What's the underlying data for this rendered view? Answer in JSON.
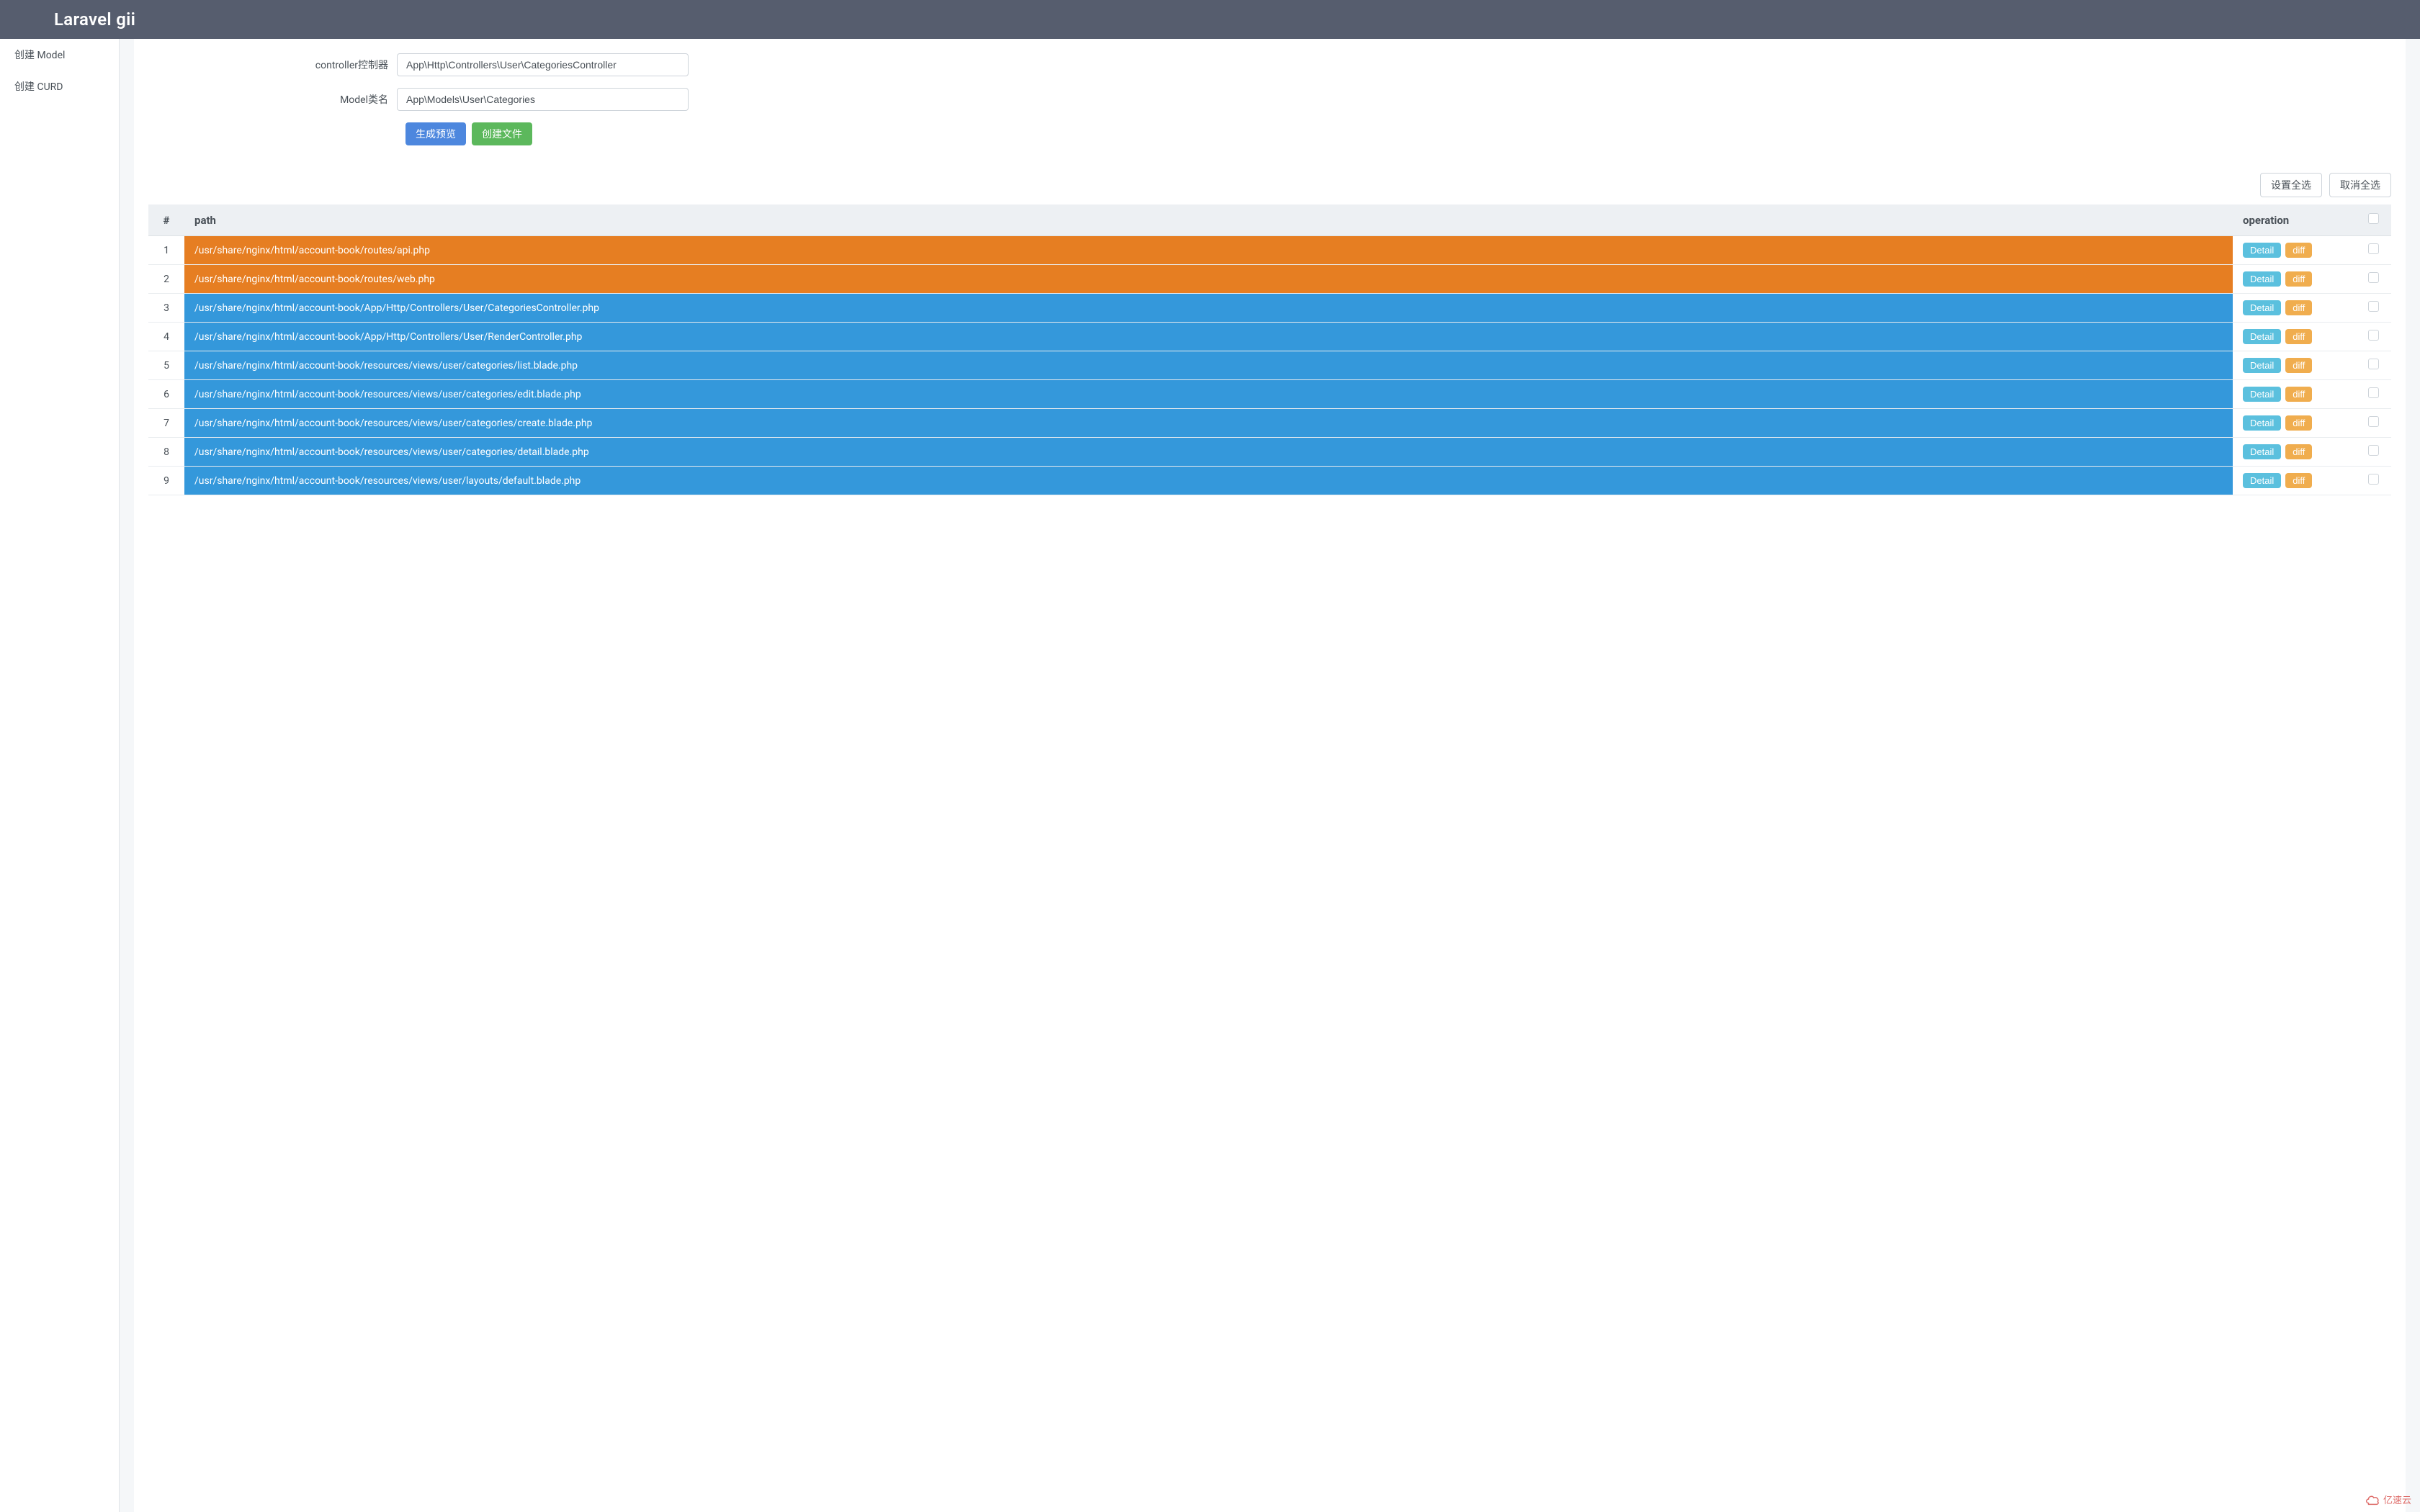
{
  "header": {
    "title": "Laravel gii"
  },
  "sidebar": {
    "items": [
      {
        "label": "创建 Model"
      },
      {
        "label": "创建 CURD"
      }
    ]
  },
  "form": {
    "controller_label": "controller控制器",
    "controller_value": "App\\Http\\Controllers\\User\\CategoriesController",
    "model_label": "Model类名",
    "model_value": "App\\Models\\User\\Categories",
    "preview_button": "生成预览",
    "create_button": "创建文件"
  },
  "select_buttons": {
    "select_all": "设置全选",
    "deselect_all": "取消全选"
  },
  "table": {
    "headers": {
      "index": "#",
      "path": "path",
      "operation": "operation"
    },
    "detail_label": "Detail",
    "diff_label": "diff",
    "rows": [
      {
        "index": "1",
        "path": "/usr/share/nginx/html/account-book/routes/api.php",
        "status": "orange"
      },
      {
        "index": "2",
        "path": "/usr/share/nginx/html/account-book/routes/web.php",
        "status": "orange"
      },
      {
        "index": "3",
        "path": "/usr/share/nginx/html/account-book/App/Http/Controllers/User/CategoriesController.php",
        "status": "blue"
      },
      {
        "index": "4",
        "path": "/usr/share/nginx/html/account-book/App/Http/Controllers/User/RenderController.php",
        "status": "blue"
      },
      {
        "index": "5",
        "path": "/usr/share/nginx/html/account-book/resources/views/user/categories/list.blade.php",
        "status": "blue"
      },
      {
        "index": "6",
        "path": "/usr/share/nginx/html/account-book/resources/views/user/categories/edit.blade.php",
        "status": "blue"
      },
      {
        "index": "7",
        "path": "/usr/share/nginx/html/account-book/resources/views/user/categories/create.blade.php",
        "status": "blue"
      },
      {
        "index": "8",
        "path": "/usr/share/nginx/html/account-book/resources/views/user/categories/detail.blade.php",
        "status": "blue"
      },
      {
        "index": "9",
        "path": "/usr/share/nginx/html/account-book/resources/views/user/layouts/default.blade.php",
        "status": "blue"
      }
    ]
  },
  "watermark": {
    "text": "亿速云"
  }
}
